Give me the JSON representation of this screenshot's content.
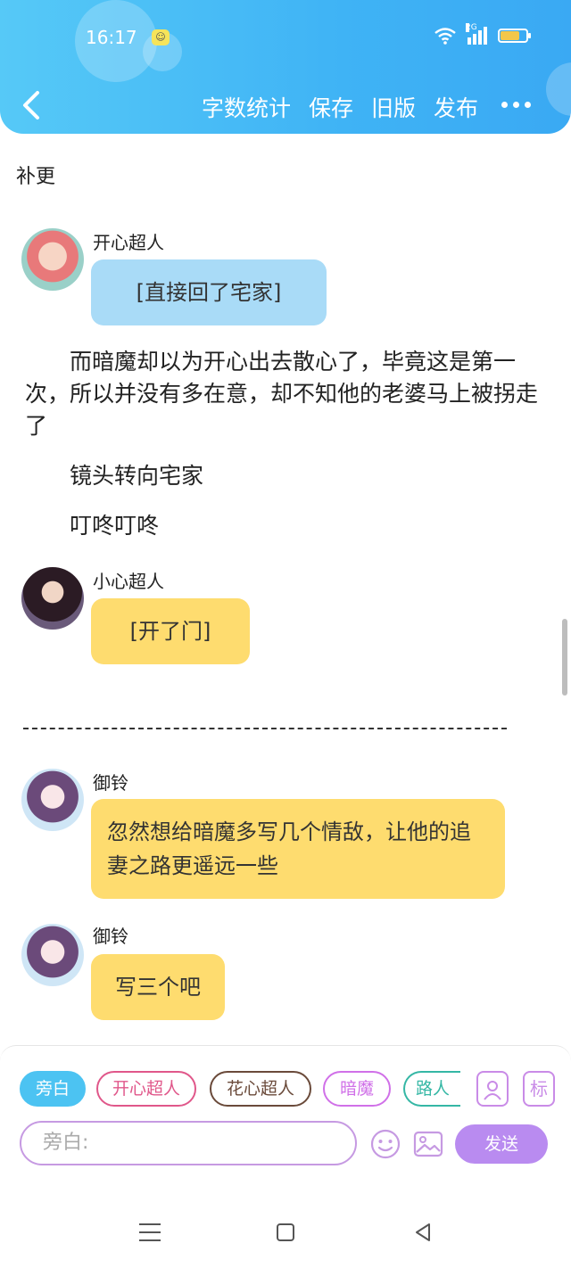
{
  "status_bar": {
    "time": "16:17",
    "network": "2G",
    "battery_level": 0.75
  },
  "toolbar": {
    "actions": [
      "字数统计",
      "保存",
      "旧版",
      "发布"
    ]
  },
  "chapter_title": "补更",
  "messages": [
    {
      "name": "开心超人",
      "text": "[直接回了宅家]",
      "bubble_color": "#a9dbf7"
    },
    {
      "name": "小心超人",
      "text": "[开了门]",
      "bubble_color": "#fedc6f"
    },
    {
      "name": "御铃",
      "text": "忽然想给暗魔多写几个情敌，让他的追妻之路更遥远一些",
      "bubble_color": "#fedc6f"
    },
    {
      "name": "御铃",
      "text": "写三个吧",
      "bubble_color": "#fedc6f"
    }
  ],
  "narration": [
    "而暗魔却以为开心出去散心了，毕竟这是第一次，所以并没有多在意，却不知他的老婆马上被拐走了",
    "镜头转向宅家",
    "叮咚叮咚"
  ],
  "composer": {
    "roles": [
      {
        "label": "旁白",
        "color": "#4cc3f2",
        "active": true
      },
      {
        "label": "开心超人",
        "color": "#e0578a",
        "active": false
      },
      {
        "label": "花心超人",
        "color": "#6a4a3a",
        "active": false
      },
      {
        "label": "暗魔",
        "color": "#d070e8",
        "active": false
      },
      {
        "label": "路人",
        "color": "#35b7a5",
        "active": false
      }
    ],
    "tag_label": "标",
    "input_placeholder": "旁白:",
    "send_label": "发送"
  }
}
